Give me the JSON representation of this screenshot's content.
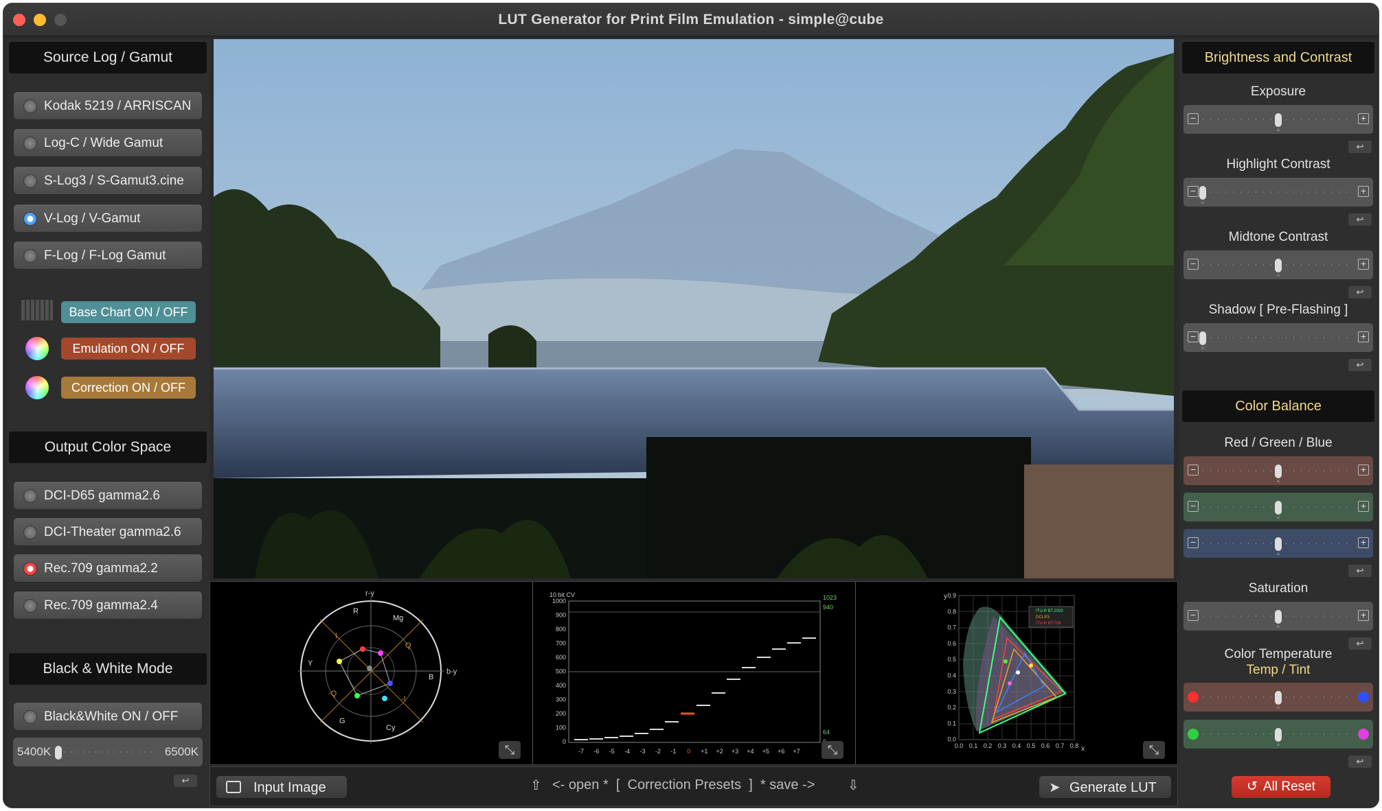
{
  "window": {
    "title": "LUT Generator for Print Film Emulation - simple@cube"
  },
  "left": {
    "source_header": "Source Log / Gamut",
    "source_items": [
      {
        "label": "Kodak 5219 / ARRISCAN",
        "selected": false
      },
      {
        "label": "Log-C / Wide Gamut",
        "selected": false
      },
      {
        "label": "S-Log3 / S-Gamut3.cine",
        "selected": false
      },
      {
        "label": "V-Log / V-Gamut",
        "selected": true
      },
      {
        "label": "F-Log / F-Log Gamut",
        "selected": false
      }
    ],
    "toggles": {
      "base_chart": "Base Chart ON / OFF",
      "emulation": "Emulation ON / OFF",
      "correction": "Correction ON / OFF"
    },
    "output_header": "Output Color Space",
    "output_items": [
      {
        "label": "DCI-D65 gamma2.6",
        "selected": false
      },
      {
        "label": "DCI-Theater gamma2.6",
        "selected": false
      },
      {
        "label": "Rec.709 gamma2.2",
        "selected": true
      },
      {
        "label": "Rec.709 gamma2.4",
        "selected": false
      }
    ],
    "bw_header": "Black & White Mode",
    "bw_toggle": "Black&White ON / OFF",
    "bw_temp_min": "5400K",
    "bw_temp_max": "6500K",
    "bw_temp_level": 0.0
  },
  "scopes": {
    "vectorscope": {
      "labels": {
        "ry": "r-y",
        "by": "b-y",
        "R": "R",
        "Mg": "Mg",
        "B": "B",
        "Cy": "Cy",
        "G": "G",
        "Y": "Y",
        "I": "I",
        "Q": "Q",
        "negQ": "-Q",
        "negI": "-I"
      }
    },
    "waveform": {
      "title": "10 bit CV",
      "y_ticks": [
        "1000",
        "900",
        "800",
        "700",
        "600",
        "500",
        "400",
        "300",
        "200",
        "100",
        "0"
      ],
      "right_ticks": [
        "1023",
        "940",
        "64",
        "0"
      ],
      "x_ticks": [
        "-7",
        "-6",
        "-5",
        "-4",
        "-3",
        "-2",
        "-1",
        "0",
        "+1",
        "+2",
        "+3",
        "+4",
        "+5",
        "+6",
        "+7"
      ]
    },
    "cie": {
      "y_label": "y",
      "x_label": "x",
      "y_ticks": [
        "0.9",
        "0.8",
        "0.7",
        "0.6",
        "0.5",
        "0.4",
        "0.3",
        "0.2",
        "0.1",
        "0.0"
      ],
      "x_ticks": [
        "0.0",
        "0.1",
        "0.2",
        "0.3",
        "0.4",
        "0.5",
        "0.6",
        "0.7",
        "0.8"
      ],
      "legend": [
        "ITU-R BT.2020",
        "DCI-P3",
        "ITU-R BT.709"
      ]
    }
  },
  "bottom": {
    "input_image": "Input Image",
    "presets": "<- open *  [  Correction Presets  ]  * save ->",
    "generate": "Generate LUT"
  },
  "right": {
    "bc_header": "Brightness and Contrast",
    "exposure": {
      "label": "Exposure",
      "level": 0.5
    },
    "highlight": {
      "label": "Highlight Contrast",
      "level": 0.0
    },
    "midtone": {
      "label": "Midtone Contrast",
      "level": 0.5
    },
    "shadow": {
      "label": "Shadow [ Pre-Flashing ]",
      "level": 0.0
    },
    "cb_header": "Color Balance",
    "rgb_label": "Red / Green / Blue",
    "red_level": 0.5,
    "green_level": 0.5,
    "blue_level": 0.5,
    "saturation": {
      "label": "Saturation",
      "level": 0.5
    },
    "temp_label_1": "Color Temperature",
    "temp_label_2": "Temp / Tint",
    "temp_level": 0.5,
    "tint_level": 0.5,
    "all_reset": "All Reset"
  },
  "colors": {
    "accent_gold": "#f2d98a",
    "reset_red": "#c8342a"
  }
}
